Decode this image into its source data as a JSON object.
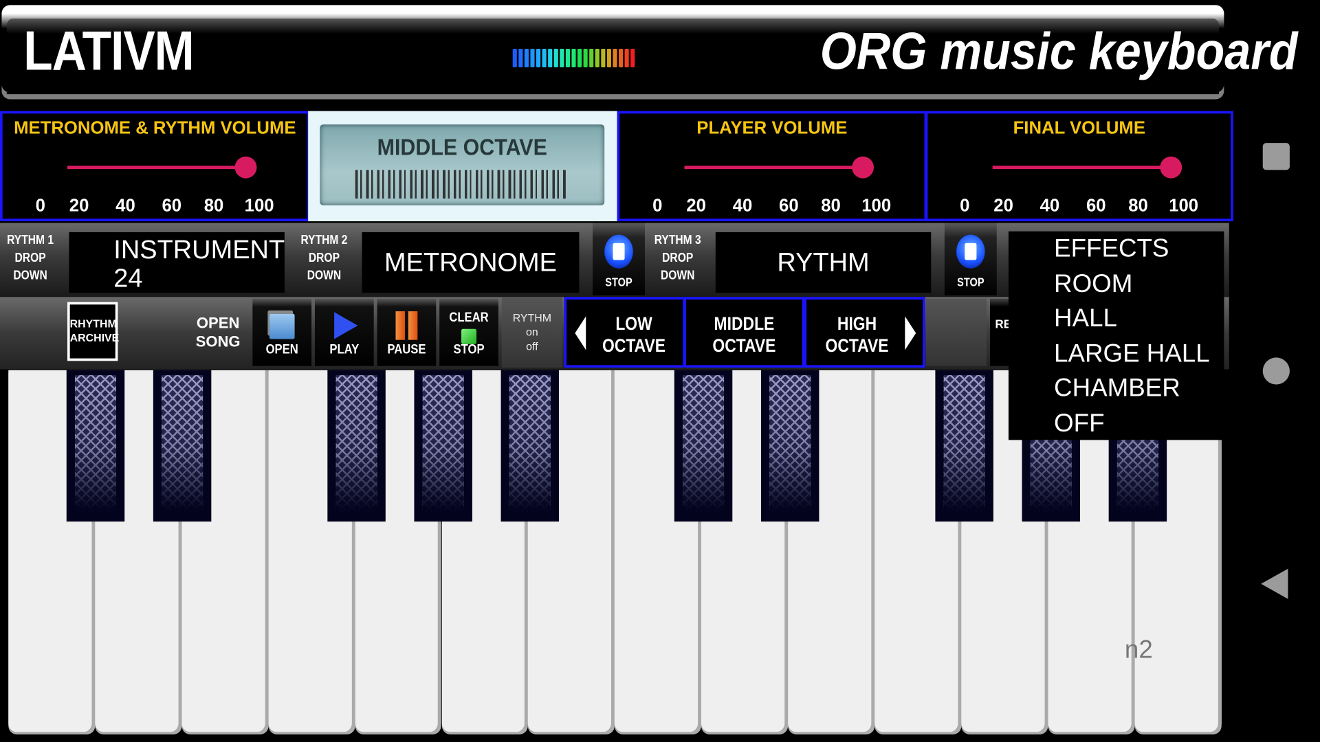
{
  "header": {
    "logo": "LATIVM",
    "title": "ORG music keyboard",
    "vu_colors": [
      "#1e5cff",
      "#1e6cff",
      "#1e80ff",
      "#1e94ff",
      "#1ea8ff",
      "#1ebcf5",
      "#1ed0e8",
      "#1ee0d0",
      "#1ee8b0",
      "#1ee890",
      "#1ee870",
      "#1ee050",
      "#30d840",
      "#60d030",
      "#90c828",
      "#b8b820",
      "#d0a020",
      "#e08020",
      "#e86020",
      "#f04020",
      "#f02020"
    ]
  },
  "volumes": [
    {
      "title": "METRONOME & RYTHM  VOLUME",
      "value_percent": 100,
      "ticks": [
        "0",
        "20",
        "40",
        "60",
        "80",
        "100"
      ]
    },
    {
      "title": "PLAYER VOLUME",
      "value_percent": 100,
      "ticks": [
        "0",
        "20",
        "40",
        "60",
        "80",
        "100"
      ]
    },
    {
      "title": "FINAL VOLUME",
      "value_percent": 100,
      "ticks": [
        "0",
        "20",
        "40",
        "60",
        "80",
        "100"
      ]
    }
  ],
  "lcd": {
    "text": "MIDDLE OCTAVE"
  },
  "selectors": {
    "rythm1_label": [
      "RYTHM 1",
      "DROP",
      "DOWN"
    ],
    "instrument_line1": "INSTRUMENT",
    "instrument_line2": "24",
    "rythm2_label": [
      "RYTHM 2",
      "DROP",
      "DOWN"
    ],
    "metronome": "METRONOME",
    "stop": "STOP",
    "rythm3_label": [
      "RYTHM 3",
      "DROP",
      "DOWN"
    ],
    "rythm": "RYTHM"
  },
  "controls": {
    "rhythm_archive": [
      "RHYTHM",
      "ARCHIVE"
    ],
    "open_song": [
      "OPEN",
      "SONG"
    ],
    "open": "OPEN",
    "play": "PLAY",
    "pause": "PAUSE",
    "clear": "CLEAR",
    "stop": "STOP",
    "rythm_toggle": [
      "RYTHM",
      "on",
      "off"
    ],
    "low_octave": [
      "LOW",
      "OCTAVE"
    ],
    "middle_octave": [
      "MIDDLE",
      "OCTAVE"
    ],
    "high_octave": [
      "HIGH",
      "OCTAVE"
    ],
    "rec_partial": "RE"
  },
  "effects_menu": [
    "EFFECTS",
    "ROOM",
    "HALL",
    "LARGE HALL",
    "CHAMBER",
    "OFF"
  ],
  "hint": "n2",
  "colors": {
    "accent_blue": "#1a14ff",
    "slider": "#d81b60",
    "title_yellow": "#f6c512"
  }
}
